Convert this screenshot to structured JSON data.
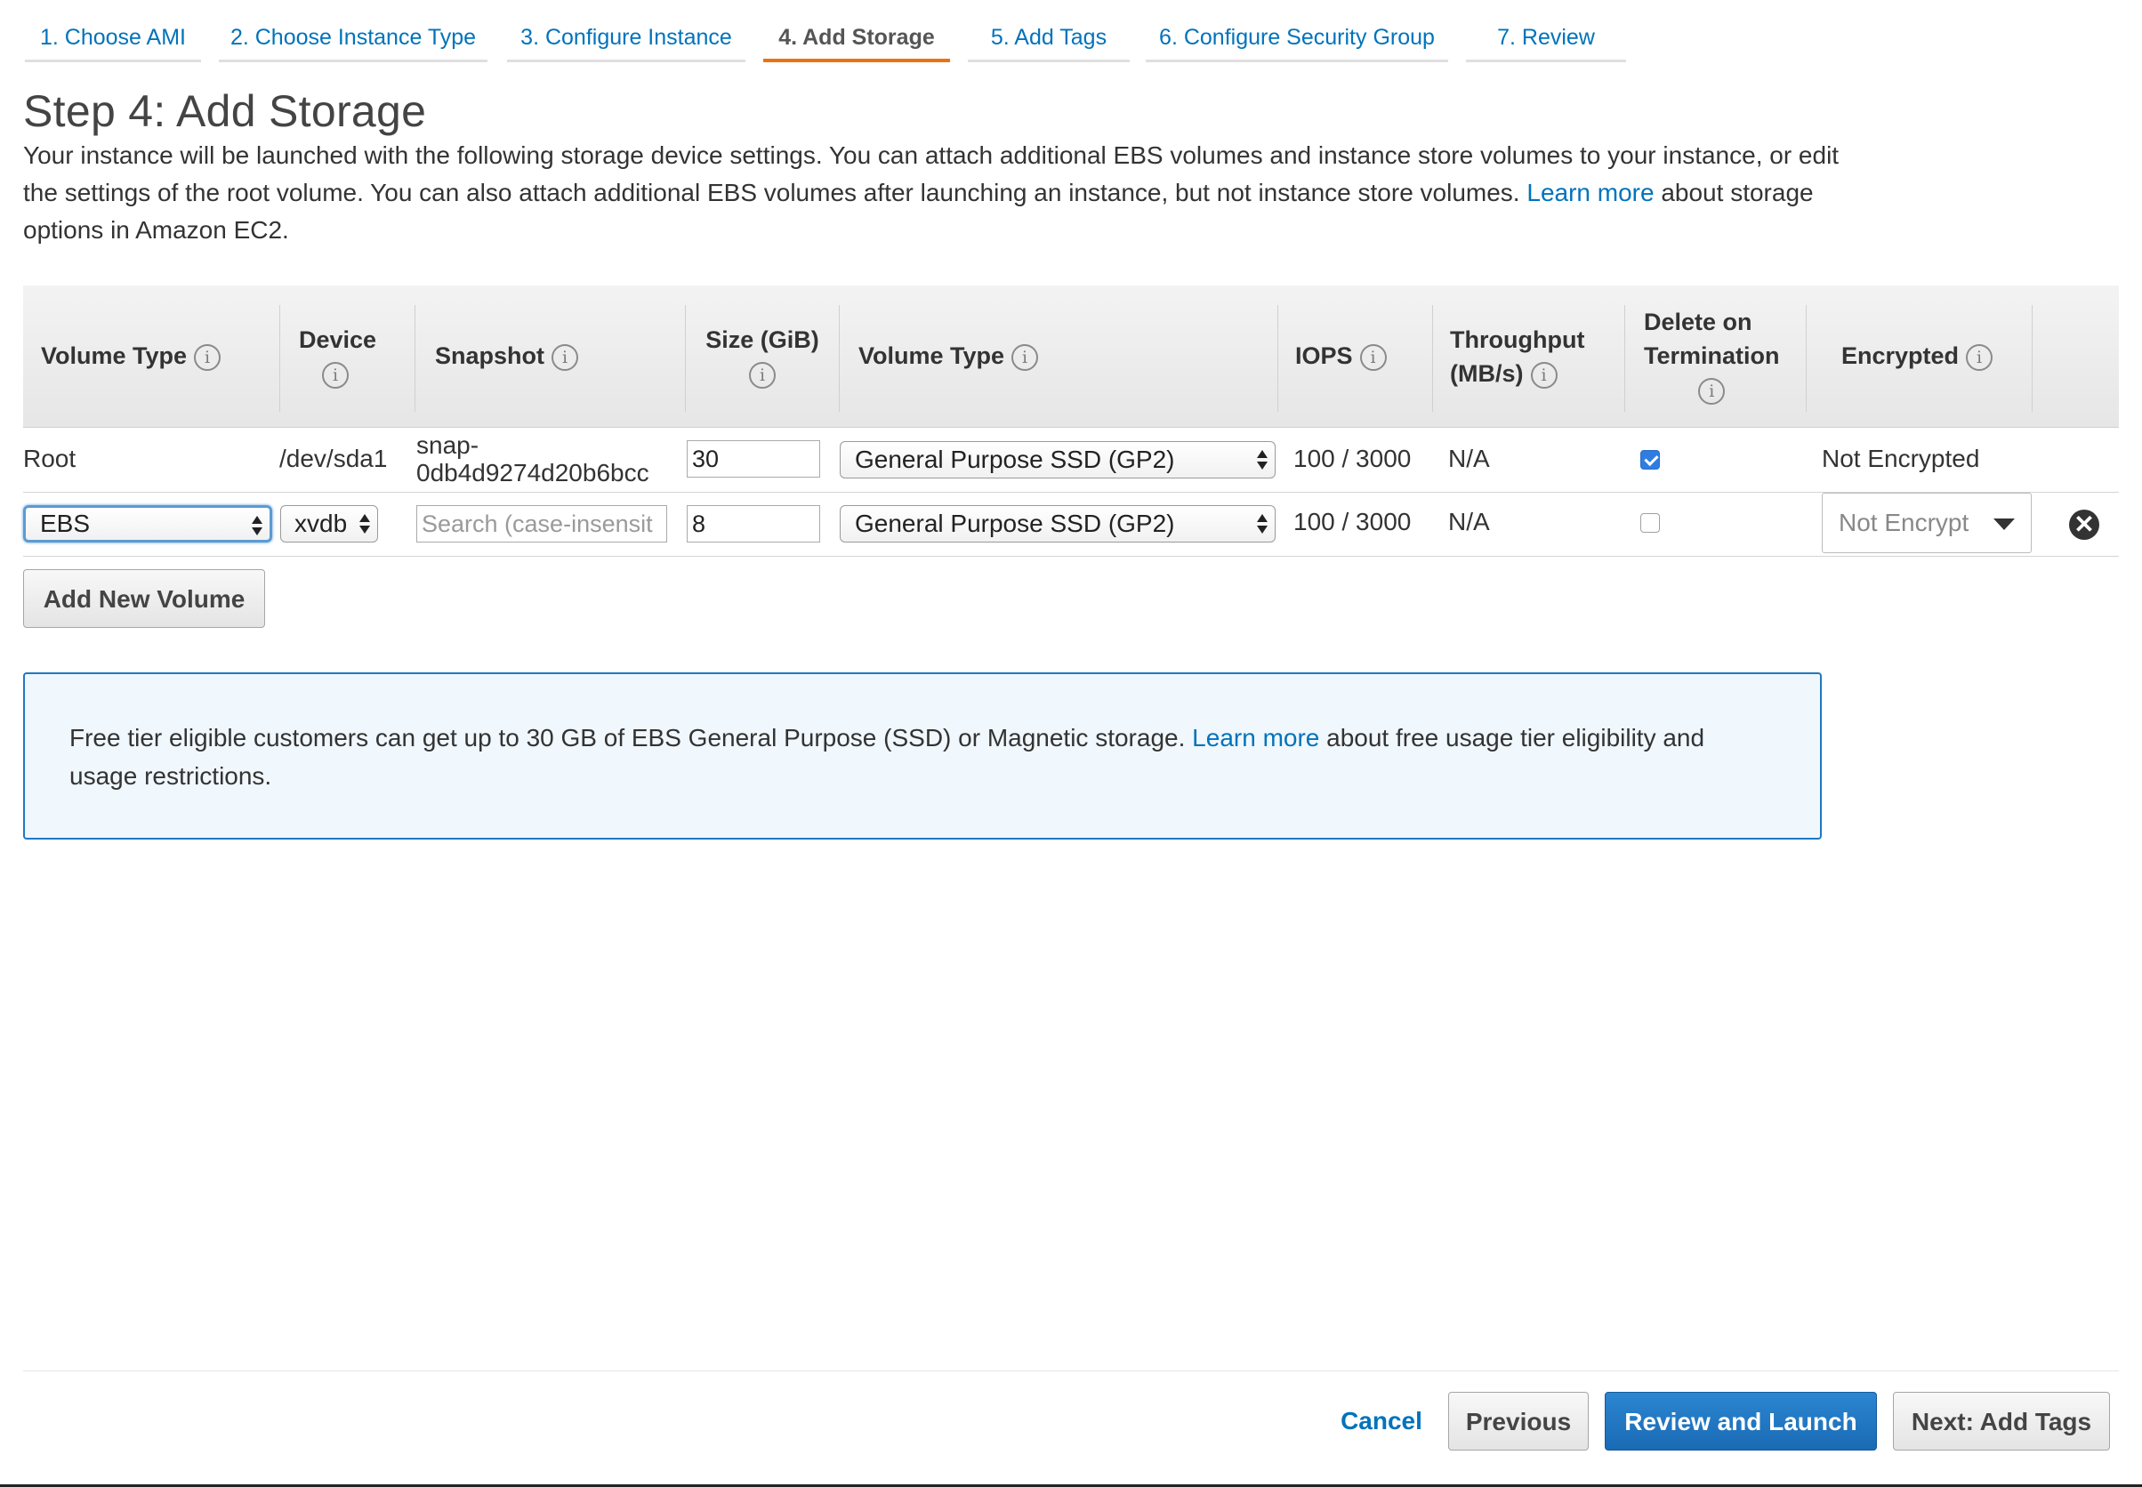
{
  "tabs": [
    {
      "label": "1. Choose AMI",
      "active": false
    },
    {
      "label": "2. Choose Instance Type",
      "active": false
    },
    {
      "label": "3. Configure Instance",
      "active": false
    },
    {
      "label": "4. Add Storage",
      "active": true
    },
    {
      "label": "5. Add Tags",
      "active": false
    },
    {
      "label": "6. Configure Security Group",
      "active": false
    },
    {
      "label": "7. Review",
      "active": false
    }
  ],
  "page": {
    "title": "Step 4: Add Storage",
    "intro_before": "Your instance will be launched with the following storage device settings. You can attach additional EBS volumes and instance store volumes to your instance, or edit the settings of the root volume. You can also attach additional EBS volumes after launching an instance, but not instance store volumes.",
    "intro_link": "Learn more",
    "intro_after": "about storage options in Amazon EC2."
  },
  "table": {
    "headers": {
      "volume_type": "Volume Type",
      "device": "Device",
      "snapshot": "Snapshot",
      "size": "Size (GiB)",
      "volume_type2": "Volume Type",
      "iops": "IOPS",
      "throughput_l1": "Throughput",
      "throughput_l2": "(MB/s)",
      "delete_l1": "Delete on",
      "delete_l2": "Termination",
      "encrypted": "Encrypted"
    },
    "info_glyph": "i",
    "rows": [
      {
        "volume_type": "Root",
        "device": "/dev/sda1",
        "snapshot_l1": "snap-",
        "snapshot_l2": "0db4d9274d20b6bcc",
        "size": "30",
        "ebs_volume_type": "General Purpose SSD (GP2)",
        "iops": "100 / 3000",
        "throughput": "N/A",
        "delete_on_termination": true,
        "encrypted": "Not Encrypted"
      },
      {
        "volume_type": "EBS",
        "device": "xvdb",
        "snapshot_placeholder": "Search (case-insensit",
        "size": "8",
        "ebs_volume_type": "General Purpose SSD (GP2)",
        "iops": "100 / 3000",
        "throughput": "N/A",
        "delete_on_termination": false,
        "encrypted": "Not Encrypt",
        "remove_glyph": "✕"
      }
    ]
  },
  "buttons": {
    "add_volume": "Add New Volume",
    "cancel": "Cancel",
    "previous": "Previous",
    "review_launch": "Review and Launch",
    "next": "Next: Add Tags"
  },
  "free_tier": {
    "before": "Free tier eligible customers can get up to 30 GB of EBS General Purpose (SSD) or Magnetic storage.",
    "link": "Learn more",
    "after": "about free usage tier eligibility and usage restrictions."
  },
  "colors": {
    "link": "#0073bb",
    "active_tab_underline": "#ec7211",
    "primary_button": "#1f78c1",
    "info_border": "#1f78c1"
  }
}
